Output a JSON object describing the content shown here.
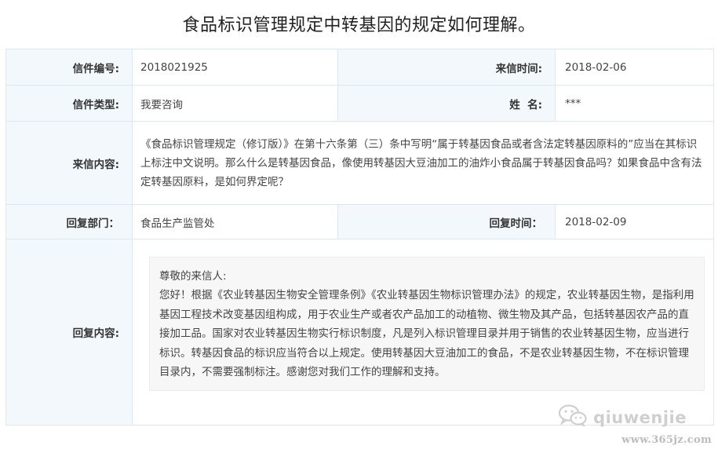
{
  "page": {
    "title": "食品标识管理规定中转基因的规定如何理解。"
  },
  "letter": {
    "number_label": "信件编号:",
    "number_value": "2018021925",
    "sent_time_label": "来信时间:",
    "sent_time_value": "2018-02-06",
    "type_label": "信件类型:",
    "type_value": "我要咨询",
    "name_label": "姓  名:",
    "name_value": "***",
    "content_label": "来信内容:",
    "content_value": "《食品标识管理规定（修订版）》在第十六条第（三）条中写明“属于转基因食品或者含法定转基因原料的”应当在其标识上标注中文说明。那么什么是转基因食品，像使用转基因大豆油加工的油炸小食品属于转基因食品吗？如果食品中含有法定转基因原料，是如何界定呢？"
  },
  "reply": {
    "dept_label": "回复部门：",
    "dept_value": "食品生产监管处",
    "time_label": "回复时间：",
    "time_value": "2018-02-09",
    "content_label": "回复内容:",
    "greeting": "尊敬的来信人:",
    "body": "您好！根据《农业转基因生物安全管理条例》《农业转基因生物标识管理办法》的规定，农业转基因生物，是指利用基因工程技术改变基因组构成，用于农业生产或者农产品加工的动植物、微生物及其产品，包括转基因农产品的直接加工品。国家对农业转基因生物实行标识制度，凡是列入标识管理目录并用于销售的农业转基因生物，应当进行标识。转基因食品的标识应当符合以上规定。使用转基因大豆油加工的食品，不是农业转基因生物，不在标识管理目录内，不需要强制标注。感谢您对我们工作的理解和支持。"
  },
  "watermark": {
    "icon": "wechat-icon",
    "text": "qiuwenjie",
    "site": "www.365jz.com"
  }
}
